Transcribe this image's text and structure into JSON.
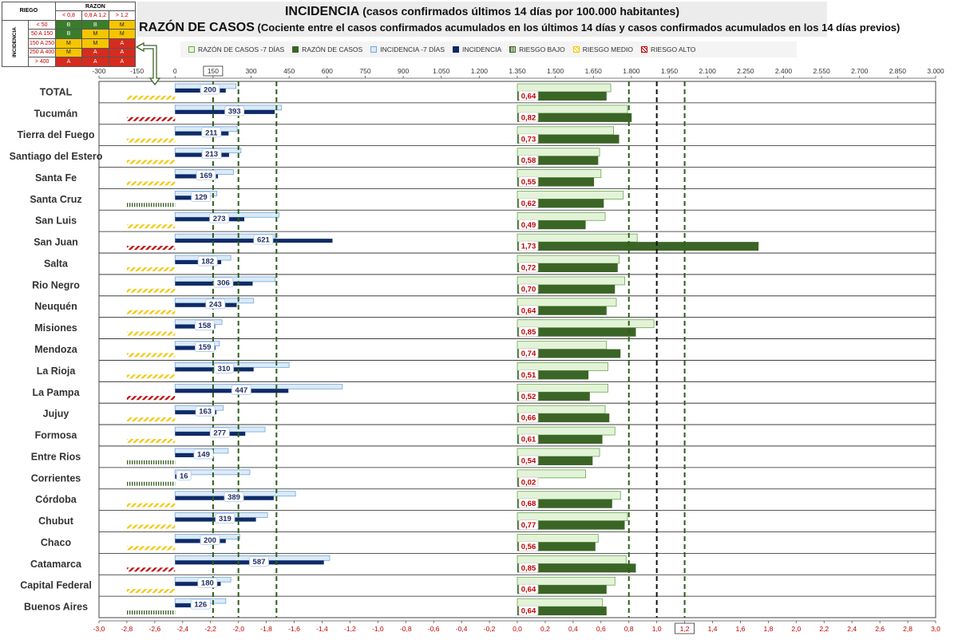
{
  "risk_table": {
    "title_riesgo": "RIEGO",
    "title_razon": "RAZON",
    "title_incidencia": "INCIDENCIA",
    "razon_cols": [
      "< 0,8",
      "0,8 A 1,2",
      "> 1,2"
    ],
    "rows": [
      {
        "label": "< 50",
        "cells": [
          "B",
          "B",
          "M"
        ]
      },
      {
        "label": "50 A 150",
        "cells": [
          "B",
          "M",
          "M"
        ]
      },
      {
        "label": "150 A 250",
        "cells": [
          "M",
          "M",
          "A"
        ]
      },
      {
        "label": "250 A 400",
        "cells": [
          "M",
          "A",
          "A"
        ]
      },
      {
        "label": "> 400",
        "cells": [
          "A",
          "A",
          "A"
        ]
      }
    ],
    "colors": {
      "B": "#3a7d2b",
      "M": "#f6c500",
      "A": "#d62b1f"
    }
  },
  "titles": {
    "line1_main": "INCIDENCIA",
    "line1_rest": "(casos confirmados últimos 14 días por 100.000 habitantes)",
    "line2_main": "RAZÓN DE CASOS",
    "line2_rest": "(Cociente entre el casos confirmados acumulados en los últimos 14 días y casos confirmados acumulados en los 14 días previos)"
  },
  "legend": [
    {
      "label": "RAZÓN DE CASOS -7 DÍAS",
      "key": "raz7"
    },
    {
      "label": "RAZÓN DE CASOS",
      "key": "raz"
    },
    {
      "label": "INCIDENCIA -7 DÍAS",
      "key": "inc7"
    },
    {
      "label": "INCIDENCIA",
      "key": "inc"
    },
    {
      "label": "RIESGO BAJO",
      "key": "bajo"
    },
    {
      "label": "RIESGO MEDIO",
      "key": "medio"
    },
    {
      "label": "RIESGO ALTO",
      "key": "alto"
    }
  ],
  "chart_data": {
    "type": "bar",
    "orientation": "horizontal",
    "categories": [
      "TOTAL",
      "Tucumán",
      "Tierra del Fuego",
      "Santiago del Estero",
      "Santa Fe",
      "Santa Cruz",
      "San Luis",
      "San Juan",
      "Salta",
      "Rio Negro",
      "Neuquén",
      "Misiones",
      "Mendoza",
      "La Rioja",
      "La Pampa",
      "Jujuy",
      "Formosa",
      "Entre Rios",
      "Corrientes",
      "Córdoba",
      "Chubut",
      "Chaco",
      "Catamarca",
      "Capital Federal",
      "Buenos Aires"
    ],
    "series": [
      {
        "name": "INCIDENCIA",
        "values": [
          200,
          393,
          211,
          213,
          169,
          129,
          273,
          621,
          182,
          306,
          243,
          158,
          159,
          310,
          447,
          163,
          277,
          149,
          16,
          389,
          319,
          200,
          587,
          180,
          126
        ]
      },
      {
        "name": "INCIDENCIA -7 DÍAS",
        "values": [
          240,
          420,
          245,
          260,
          230,
          165,
          410,
          395,
          220,
          395,
          310,
          185,
          175,
          450,
          660,
          190,
          355,
          210,
          295,
          475,
          365,
          255,
          610,
          220,
          200
        ]
      },
      {
        "name": "RAZÓN DE CASOS",
        "values": [
          0.64,
          0.82,
          0.73,
          0.58,
          0.55,
          0.62,
          0.49,
          1.73,
          0.72,
          0.7,
          0.64,
          0.85,
          0.74,
          0.51,
          0.52,
          0.66,
          0.61,
          0.54,
          0.02,
          0.68,
          0.77,
          0.56,
          0.85,
          0.64,
          0.64
        ]
      },
      {
        "name": "RAZÓN DE CASOS -7 DÍAS",
        "values": [
          0.67,
          0.79,
          0.69,
          0.59,
          0.6,
          0.76,
          0.63,
          0.86,
          0.73,
          0.77,
          0.71,
          0.98,
          0.64,
          0.65,
          0.65,
          0.63,
          0.7,
          0.59,
          0.49,
          0.74,
          0.79,
          0.58,
          0.78,
          0.7,
          0.61
        ]
      },
      {
        "name": "RIESGO",
        "values": [
          "medio",
          "alto",
          "medio",
          "medio",
          "medio",
          "bajo",
          "medio",
          "alto",
          "medio",
          "medio",
          "medio",
          "medio",
          "medio",
          "medio",
          "alto",
          "medio",
          "medio",
          "bajo",
          "bajo",
          "medio",
          "medio",
          "medio",
          "alto",
          "medio",
          "bajo"
        ]
      }
    ],
    "incidencia_axis": {
      "min": -300,
      "max": 3000,
      "ticks": [
        "-300",
        "-150",
        "0",
        "150",
        "300",
        "450",
        "600",
        "750",
        "900",
        "1.050",
        "1.200",
        "1.350",
        "1.500",
        "1.650",
        "1.800",
        "1.950",
        "2.100",
        "2.250",
        "2.400",
        "2.550",
        "2.700",
        "2.850",
        "3.000"
      ],
      "highlight": "150"
    },
    "razon_axis": {
      "min": -3.0,
      "max": 3.0,
      "ticks": [
        "-3,0",
        "-2,8",
        "-2,6",
        "-2,4",
        "-2,2",
        "-2,0",
        "-1,8",
        "-1,6",
        "-1,4",
        "-1,2",
        "-1,0",
        "-0,8",
        "-0,6",
        "-0,4",
        "-0,2",
        "0,0",
        "0,2",
        "0,4",
        "0,6",
        "0,8",
        "1,0",
        "1,2",
        "1,4",
        "1,6",
        "1,8",
        "2,0",
        "2,2",
        "2,4",
        "2,6",
        "2,8",
        "3,0"
      ],
      "highlight": "1,2"
    },
    "reference_lines": {
      "incidencia": [
        150,
        250,
        400
      ],
      "razon": [
        0.8,
        1.2
      ],
      "razon_black": 1.0
    },
    "grid": true,
    "legend_position": "top"
  }
}
